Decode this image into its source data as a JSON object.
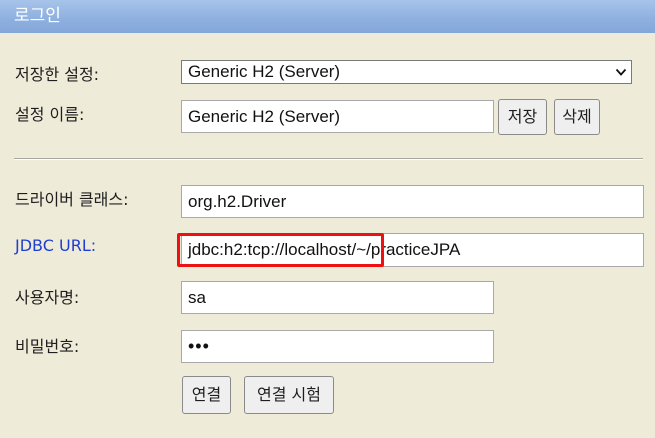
{
  "window": {
    "title": "로그인"
  },
  "saved_settings": {
    "label": "저장한 설정:",
    "selected": "Generic H2 (Server)"
  },
  "setting_name": {
    "label": "설정 이름:",
    "value": "Generic H2 (Server)",
    "save_label": "저장",
    "delete_label": "삭제"
  },
  "driver_class": {
    "label": "드라이버 클래스:",
    "value": "org.h2.Driver"
  },
  "jdbc_url": {
    "label": "JDBC URL:",
    "value": "jdbc:h2:tcp://localhost/~/practiceJPA"
  },
  "username": {
    "label": "사용자명:",
    "value": "sa"
  },
  "password": {
    "label": "비밀번호:",
    "masked": "•••"
  },
  "actions": {
    "connect_label": "연결",
    "test_connect_label": "연결 시험"
  },
  "colors": {
    "titlebar": "#8fb1e0",
    "background": "#eeebd9",
    "link_label": "#1f3fd0",
    "highlight": "#ee1111"
  }
}
